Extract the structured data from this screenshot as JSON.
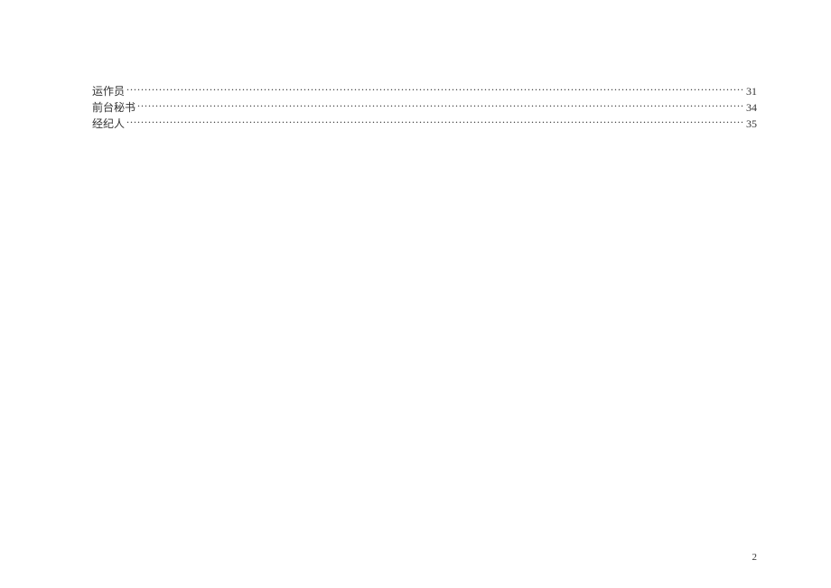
{
  "toc": {
    "entries": [
      {
        "title": "运作员",
        "page": "31"
      },
      {
        "title": "前台秘书",
        "page": "34"
      },
      {
        "title": "经纪人",
        "page": "35"
      }
    ]
  },
  "footer": {
    "page_number": "2"
  }
}
